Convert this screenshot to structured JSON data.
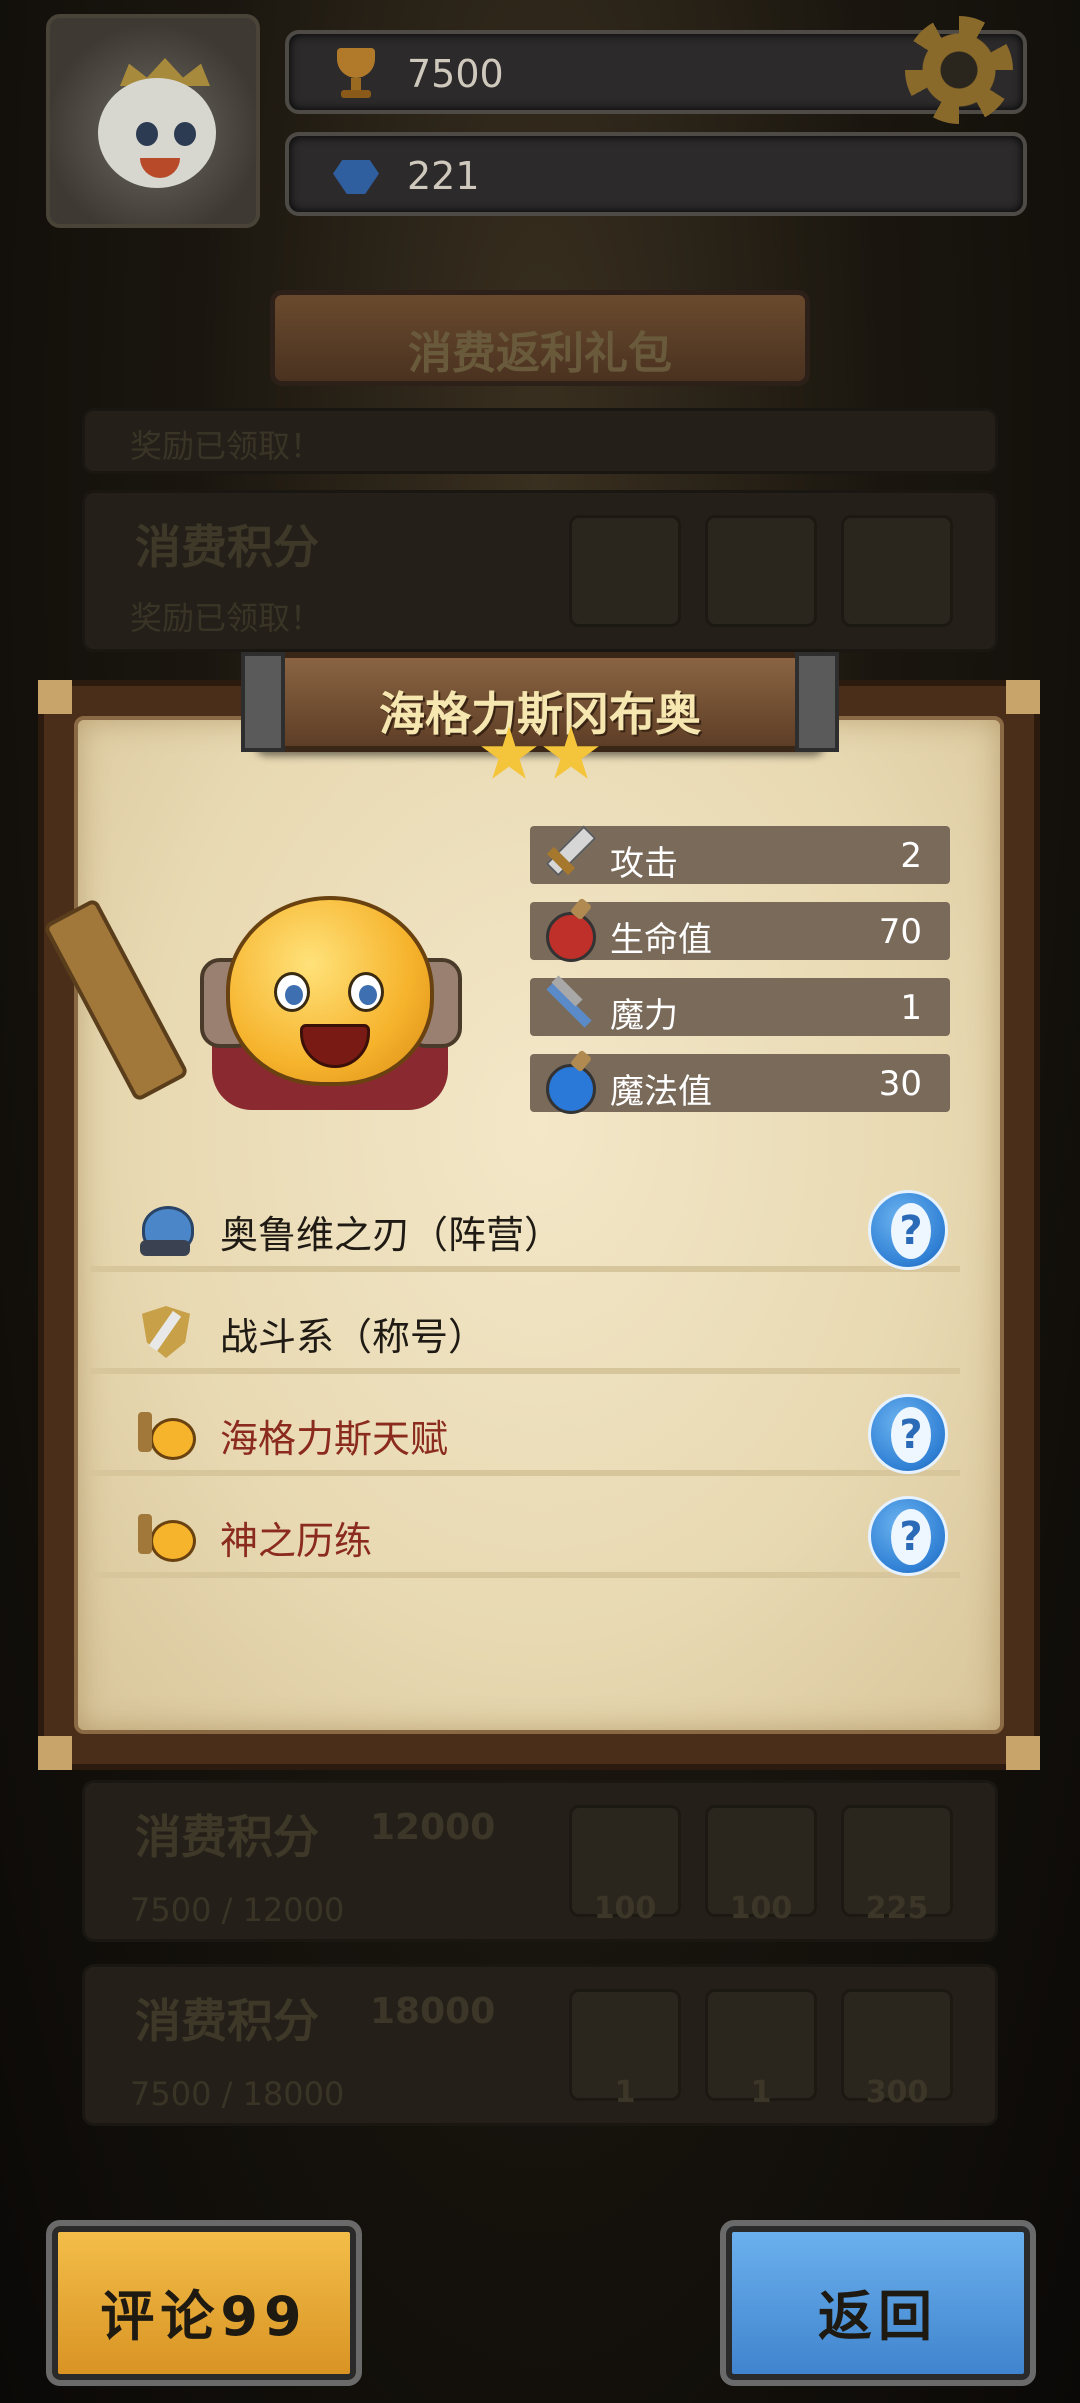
{
  "header": {
    "trophy_value": "7500",
    "gem_value": "221"
  },
  "background_panel": {
    "title": "消费返利礼包",
    "rows": [
      {
        "label": "",
        "status": "奖励已领取！"
      },
      {
        "label": "消费积分",
        "status": "奖励已领取！"
      },
      {
        "label": "消费积分",
        "points": "12000",
        "progress": "7500 / 12000",
        "rewards": [
          "100",
          "100",
          "225"
        ]
      },
      {
        "label": "消费积分",
        "points": "18000",
        "progress": "7500 / 18000",
        "rewards": [
          "1",
          "1",
          "300"
        ]
      }
    ]
  },
  "hero_card": {
    "name": "海格力斯冈布奥",
    "stars": 2,
    "stats": [
      {
        "icon": "sword-icon",
        "label": "攻击",
        "value": "2"
      },
      {
        "icon": "potion-red-icon",
        "label": "生命值",
        "value": "70"
      },
      {
        "icon": "staff-icon",
        "label": "魔力",
        "value": "1"
      },
      {
        "icon": "potion-blue-icon",
        "label": "魔法值",
        "value": "30"
      }
    ],
    "attributes": [
      {
        "icon": "faction-icon",
        "text": "奥鲁维之刃（阵营）",
        "color": "#1f1a14",
        "help": true
      },
      {
        "icon": "shield-icon",
        "text": "战斗系（称号）",
        "color": "#1f1a14",
        "help": false
      },
      {
        "icon": "hero-mini-icon",
        "text": "海格力斯天赋",
        "color": "#8a2b1e",
        "help": true
      },
      {
        "icon": "hero-mini-icon",
        "text": "神之历练",
        "color": "#8a2b1e",
        "help": true
      }
    ],
    "help_symbol": "?"
  },
  "buttons": {
    "comment_label": "评论99",
    "back_label": "返回"
  }
}
